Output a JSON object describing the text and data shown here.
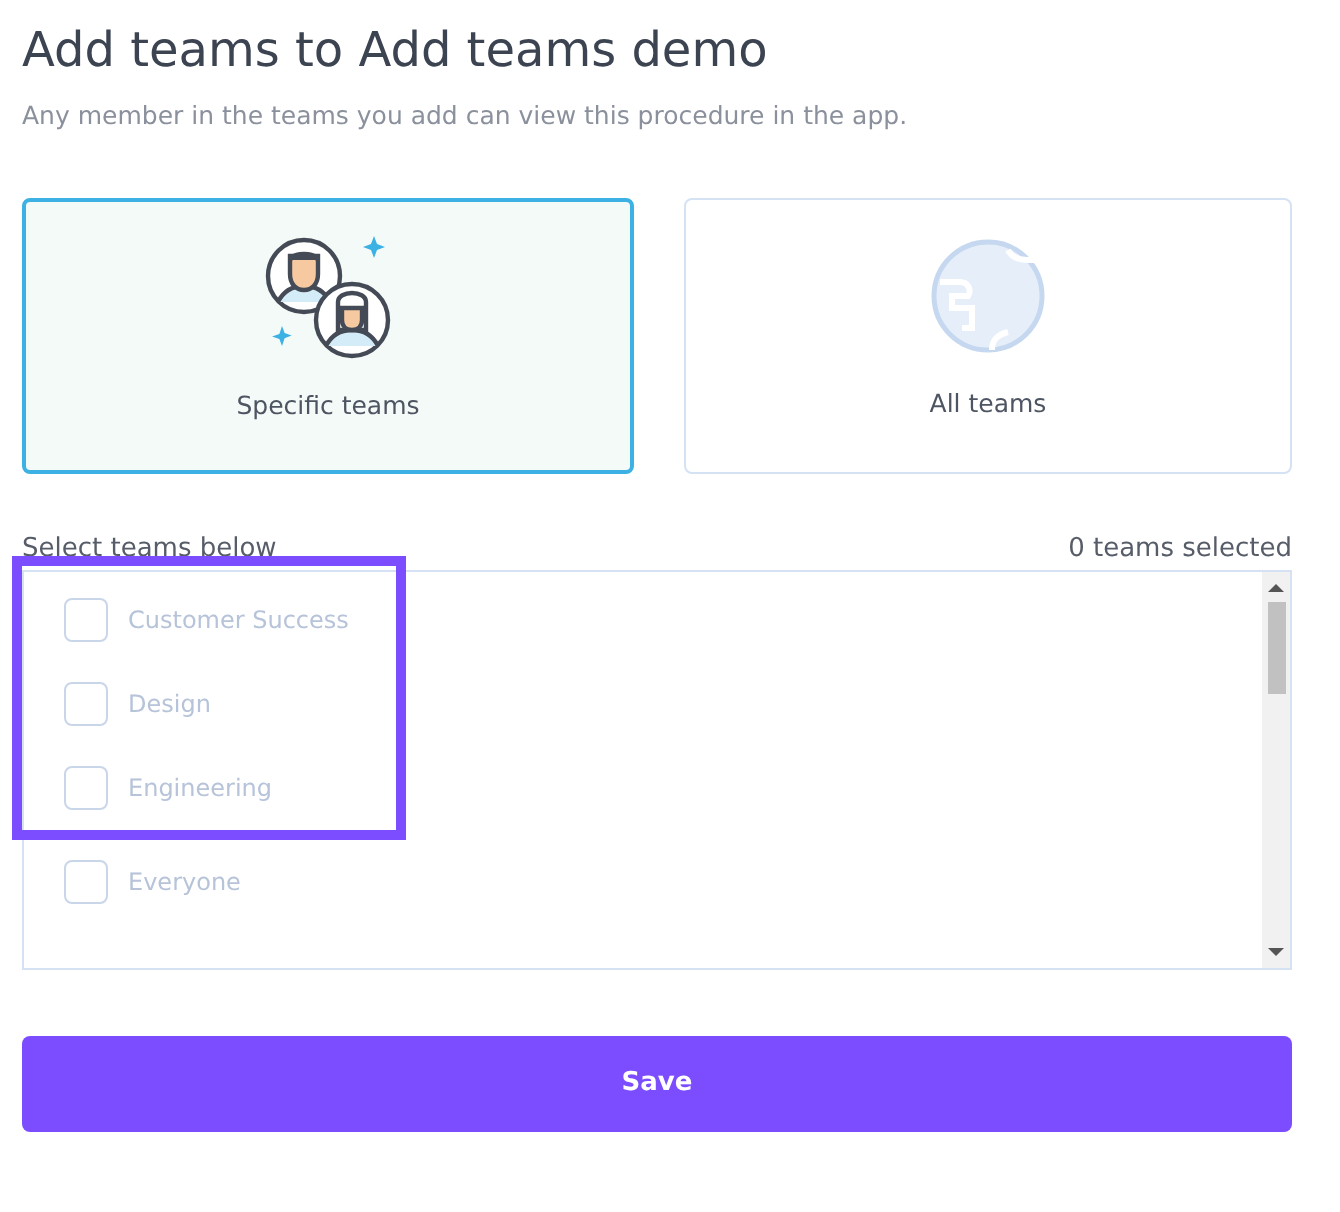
{
  "title": "Add teams to Add teams demo",
  "subtitle": "Any member in the teams you add can view this procedure in the app.",
  "options": [
    {
      "kind": "specific",
      "label": "Specific teams",
      "selected": true
    },
    {
      "kind": "all",
      "label": "All teams",
      "selected": false
    }
  ],
  "list_label": "Select teams below",
  "selected_count": "0 teams selected",
  "teams": [
    {
      "name": "Customer Success",
      "checked": false,
      "highlighted": true
    },
    {
      "name": "Design",
      "checked": false,
      "highlighted": true
    },
    {
      "name": "Engineering",
      "checked": false,
      "highlighted": true
    },
    {
      "name": "Everyone",
      "checked": false,
      "highlighted": false
    }
  ],
  "save_button": "Save"
}
